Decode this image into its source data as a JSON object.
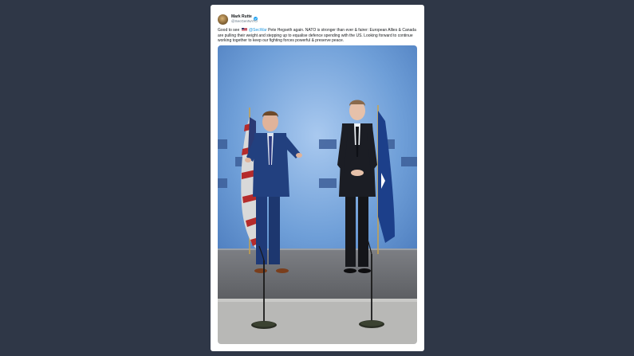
{
  "tweet": {
    "author_name": "Mark Rutte",
    "handle": "@SecGenNATO",
    "text_before": "Good to see",
    "mention": "@SecWar",
    "text_after": "Pete Hegseth again. NATO is stronger than ever & fairer: European Allies & Canada are pulling their weight and stepping up to equalise defence spending with the US. Looking forward to continue working together to keep our fighting forces powerful & preserve peace.",
    "photo_backdrop_label": "NATO OTAN"
  },
  "icons": {
    "verified": "verified-badge-icon",
    "flag": "us-flag-emoji"
  },
  "colors": {
    "background": "#2f3747",
    "card": "#ffffff",
    "link": "#1b95e0",
    "backdrop": "#6f9fd8"
  }
}
